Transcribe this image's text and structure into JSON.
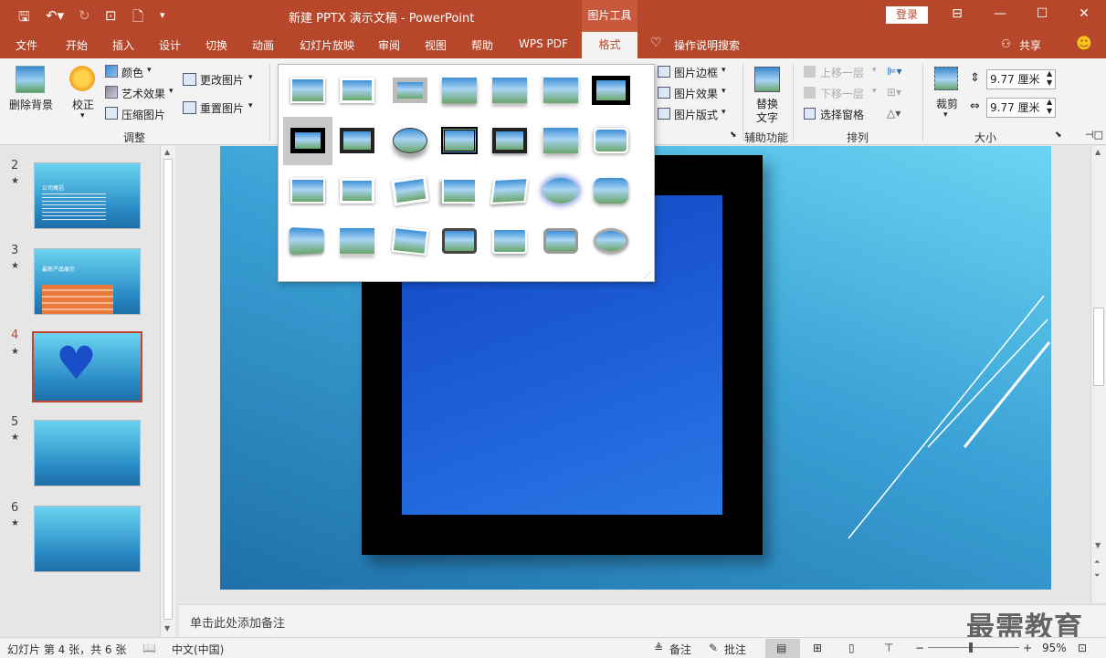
{
  "titlebar": {
    "title": "新建 PPTX 演示文稿  -  PowerPoint",
    "context_tab": "图片工具",
    "login": "登录"
  },
  "menu": {
    "items": [
      "文件",
      "开始",
      "插入",
      "设计",
      "切换",
      "动画",
      "幻灯片放映",
      "审阅",
      "视图",
      "帮助",
      "WPS PDF"
    ],
    "active": "格式",
    "search": "操作说明搜索",
    "share": "共享"
  },
  "ribbon": {
    "remove_bg": "删除背景",
    "correct": "校正",
    "color": "颜色",
    "art_effects": "艺术效果",
    "compress": "压缩图片",
    "change_pic": "更改图片",
    "reset_pic": "重置图片",
    "group_adjust": "调整",
    "pic_border": "图片边框",
    "pic_effects": "图片效果",
    "pic_layout": "图片版式",
    "alt_text_1": "替换",
    "alt_text_2": "文字",
    "group_access": "辅助功能",
    "bring_forward": "上移一层",
    "send_backward": "下移一层",
    "selection_pane": "选择窗格",
    "group_arrange": "排列",
    "crop": "裁剪",
    "height": "9.77 厘米",
    "width": "9.77 厘米",
    "group_size": "大小"
  },
  "slides": [
    {
      "num": "2",
      "caption": "公司概括"
    },
    {
      "num": "3",
      "caption": "最新产品展示"
    },
    {
      "num": "4"
    },
    {
      "num": "5"
    },
    {
      "num": "6"
    }
  ],
  "notes": {
    "placeholder": "单击此处添加备注"
  },
  "status": {
    "slide_info": "幻灯片 第 4 张，共 6 张",
    "language": "中文(中国)",
    "notes": "备注",
    "comments": "批注",
    "zoom": "95%"
  },
  "watermark": "最需教育",
  "colors": {
    "accent": "#b7472a",
    "selected_thumb": "#c5452e"
  }
}
